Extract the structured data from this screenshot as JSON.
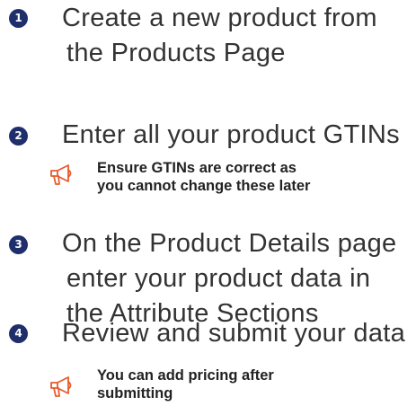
{
  "colors": {
    "badge": "#1f2f6b",
    "icon": "#e65c2e",
    "text": "#333333",
    "note_text": "#222222"
  },
  "steps": [
    {
      "number": "1",
      "lines": [
        "Create a new product from",
        "the Products Page"
      ]
    },
    {
      "number": "2",
      "lines": [
        "Enter all your product GTINs"
      ],
      "note": {
        "icon": "megaphone-icon",
        "lines": [
          "Ensure GTINs are correct as",
          "you cannot change these later"
        ]
      }
    },
    {
      "number": "3",
      "lines": [
        "On the Product Details page",
        "enter your product data in",
        "the Attribute Sections"
      ]
    },
    {
      "number": "4",
      "lines": [
        "Review and submit your data"
      ],
      "note": {
        "icon": "megaphone-icon",
        "lines": [
          "You can add pricing after",
          "submitting"
        ]
      }
    }
  ]
}
